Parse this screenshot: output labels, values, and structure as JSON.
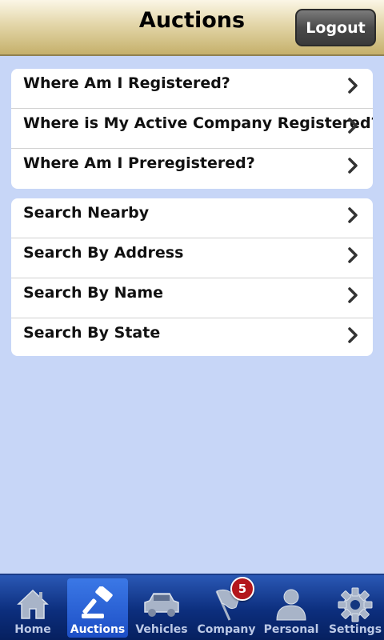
{
  "header": {
    "title": "Auctions",
    "logout_label": "Logout"
  },
  "registration_menu": {
    "items": [
      {
        "label": "Where Am I Registered?"
      },
      {
        "label": "Where is My Active Company Registered?"
      },
      {
        "label": "Where Am I Preregistered?"
      }
    ]
  },
  "search_menu": {
    "items": [
      {
        "label": "Search Nearby"
      },
      {
        "label": "Search By Address"
      },
      {
        "label": "Search By Name"
      },
      {
        "label": "Search By State"
      }
    ]
  },
  "tabbar": {
    "active_tab": "Auctions",
    "company_badge": "5",
    "tabs": [
      {
        "label": "Home",
        "icon": "house-icon"
      },
      {
        "label": "Auctions",
        "icon": "gavel-icon"
      },
      {
        "label": "Vehicles",
        "icon": "car-icon"
      },
      {
        "label": "Company",
        "icon": "flag-icon"
      },
      {
        "label": "Personal",
        "icon": "person-icon"
      },
      {
        "label": "Settings",
        "icon": "gear-icon"
      }
    ]
  },
  "colors": {
    "background": "#c7d6f7",
    "header_gold": "#d8c78f",
    "tabbar_blue": "#0c2e7d",
    "active_tab_blue": "#2e64d8",
    "badge_red": "#b3161b"
  }
}
